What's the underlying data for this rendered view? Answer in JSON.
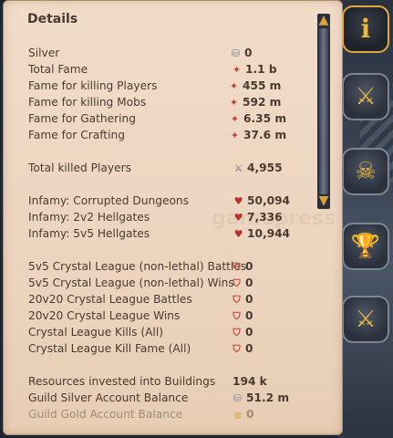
{
  "panel": {
    "title": "Details",
    "watermark": "gamepress"
  },
  "rows": [
    {
      "label": "Silver",
      "icon": "silver-coins-icon",
      "value": "0"
    },
    {
      "label": "Total Fame",
      "icon": "fame-icon",
      "value": "1.1 b"
    },
    {
      "label": "Fame for killing Players",
      "icon": "fame-icon",
      "value": "455 m"
    },
    {
      "label": "Fame for killing Mobs",
      "icon": "fame-icon",
      "value": "592 m"
    },
    {
      "label": "Fame for Gathering",
      "icon": "fame-icon",
      "value": "6.35 m"
    },
    {
      "label": "Fame for Crafting",
      "icon": "fame-icon",
      "value": "37.6 m"
    },
    {
      "label": "Total killed Players",
      "icon": "crossed-swords-icon",
      "value": "4,955"
    },
    {
      "label": "Infamy: Corrupted Dungeons",
      "icon": "infamy-icon",
      "value": "50,094"
    },
    {
      "label": "Infamy: 2v2 Hellgates",
      "icon": "infamy-icon",
      "value": "7,336"
    },
    {
      "label": "Infamy: 5v5 Hellgates",
      "icon": "infamy-icon",
      "value": "10,944"
    },
    {
      "label": "5v5 Crystal League (non-lethal) Battles",
      "icon": "shield-icon",
      "value": "0"
    },
    {
      "label": "5v5 Crystal League (non-lethal) Wins",
      "icon": "shield-icon",
      "value": "0"
    },
    {
      "label": "20v20 Crystal League Battles",
      "icon": "shield-icon",
      "value": "0"
    },
    {
      "label": "20v20 Crystal League Wins",
      "icon": "shield-icon",
      "value": "0"
    },
    {
      "label": "Crystal League Kills (All)",
      "icon": "shield-icon",
      "value": "0"
    },
    {
      "label": "Crystal League Kill Fame (All)",
      "icon": "shield-fame-icon",
      "value": "0"
    },
    {
      "label": "Resources invested into Buildings",
      "icon": "",
      "value": "194 k"
    },
    {
      "label": "Guild Silver Account Balance",
      "icon": "silver-coins-icon",
      "value": "51.2 m"
    },
    {
      "label": "Guild Gold Account Balance",
      "icon": "gold-coin-icon",
      "value": "0"
    }
  ],
  "tabs": [
    {
      "name": "info",
      "icon": "info-icon",
      "glyph": "i"
    },
    {
      "name": "combat",
      "icon": "crossed-swords-icon",
      "glyph": "⚔"
    },
    {
      "name": "skull",
      "icon": "skull-crossbones-icon",
      "glyph": "☠"
    },
    {
      "name": "trophy",
      "icon": "trophy-icon",
      "glyph": "🏆"
    },
    {
      "name": "guild-war",
      "icon": "globe-swords-icon",
      "glyph": "⚔"
    }
  ],
  "colors": {
    "panel_bg": "#efd9c4",
    "text": "#4a3a30",
    "accent_gold": "#e0a83e",
    "fame_red": "#c0443a"
  }
}
